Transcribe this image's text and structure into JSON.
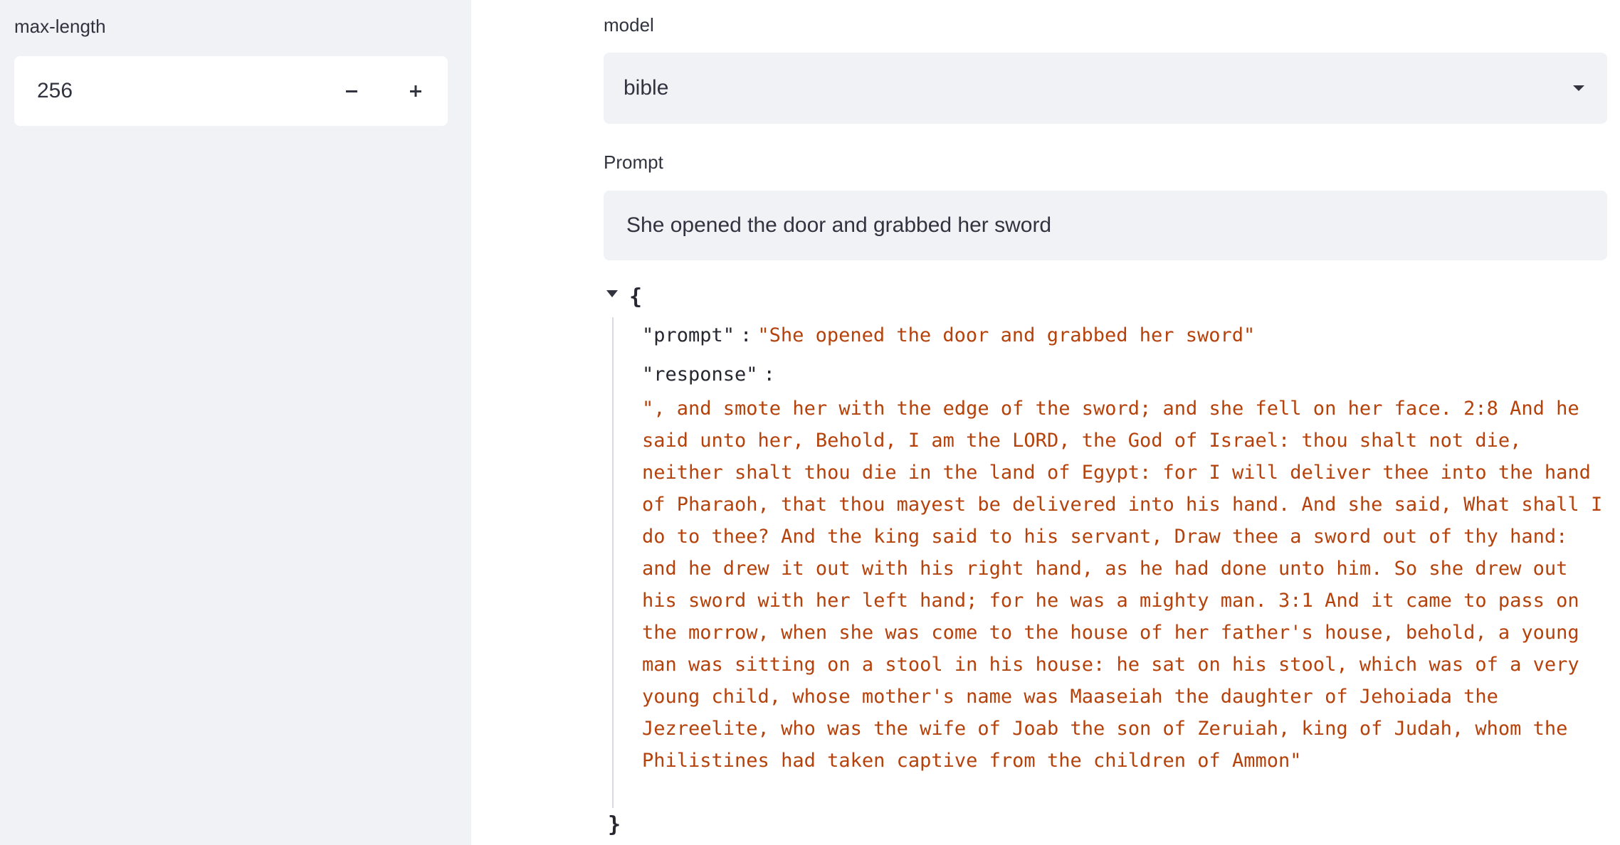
{
  "sidebar": {
    "max_length": {
      "label": "max-length",
      "value": "256",
      "decrement_symbol": "−",
      "increment_symbol": "+"
    }
  },
  "main": {
    "model": {
      "label": "model",
      "selected": "bible"
    },
    "prompt": {
      "label": "Prompt",
      "value": "She opened the door and grabbed her sword"
    },
    "json_output": {
      "open_brace": "{",
      "close_brace": "}",
      "prompt_key": "\"prompt\"",
      "prompt_value": "\"She opened the door and grabbed her sword\"",
      "response_key": "\"response\"",
      "separator": ":",
      "response_value": "\", and smote her with the edge of the sword; and she fell on her face. 2:8 And he said unto her, Behold, I am the LORD, the God of Israel: thou shalt not die, neither shalt thou die in the land of Egypt: for I will deliver thee into the hand of Pharaoh, that thou mayest be delivered into his hand. And she said, What shall I do to thee? And the king said to his servant, Draw thee a sword out of thy hand: and he drew it out with his right hand, as he had done unto him. So she drew out his sword with her left hand; for he was a mighty man. 3:1 And it came to pass on the morrow, when she was come to the house of her father's house, behold, a young man was sitting on a stool in his house: he sat on his stool, which was of a very young child, whose mother's name was Maaseiah the daughter of Jehoiada the Jezreelite, who was the wife of Joab the son of Zeruiah, king of Judah, whom the Philistines had taken captive from the children of Ammon\""
    }
  },
  "icons": {
    "dropdown": "chevron-down-icon",
    "json_toggle": "collapse-triangle-icon",
    "minus": "minus-icon",
    "plus": "plus-icon"
  },
  "colors": {
    "sidebar_bg": "#f0f2f6",
    "input_bg": "#f0f2f6",
    "json_string": "#b5410b",
    "text": "#31333f"
  }
}
